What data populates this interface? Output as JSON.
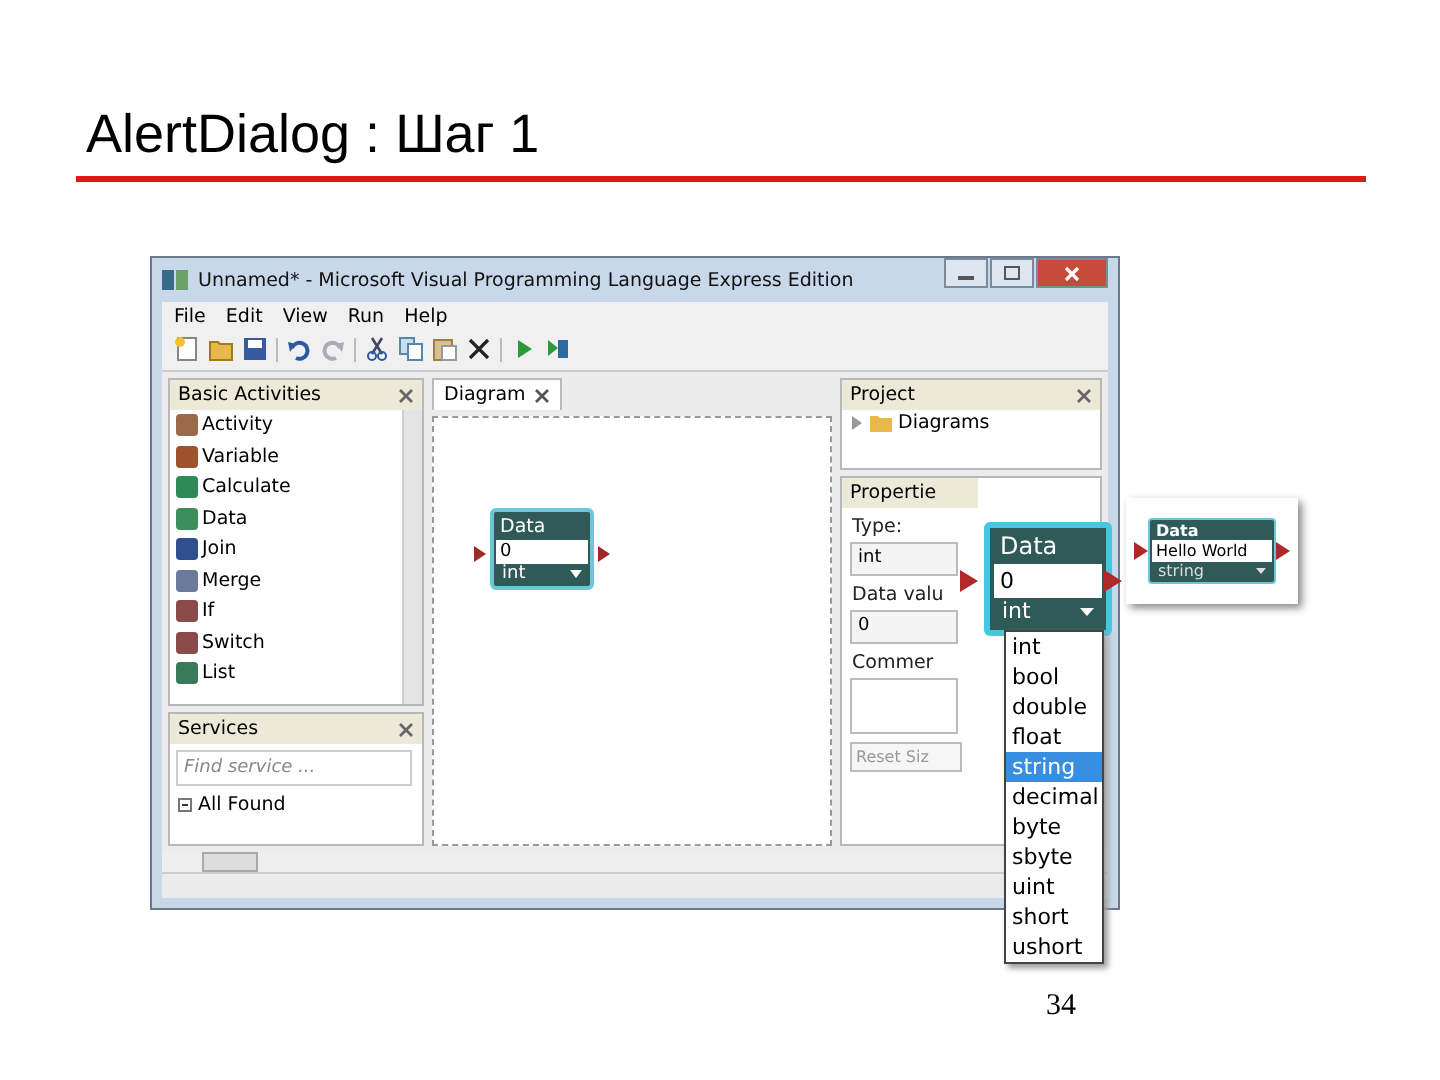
{
  "slide": {
    "title": "AlertDialog : Шаг 1",
    "page_number": "34"
  },
  "window": {
    "title": "Unnamed* - Microsoft Visual Programming Language  Express Edition"
  },
  "menu": [
    "File",
    "Edit",
    "View",
    "Run",
    "Help"
  ],
  "basic_activities": {
    "title": "Basic Activities",
    "items": [
      "Activity",
      "Variable",
      "Calculate",
      "Data",
      "Join",
      "Merge",
      "If",
      "Switch",
      "List"
    ]
  },
  "services": {
    "title": "Services",
    "search": {
      "placeholder": "Find service ..."
    },
    "tree": [
      {
        "label": "All Found",
        "expanded": true
      }
    ]
  },
  "diagram": {
    "tab": "Diagram",
    "node": {
      "title": "Data",
      "value": "0",
      "type": "int"
    }
  },
  "project": {
    "title": "Project",
    "items": [
      {
        "label": "Diagrams",
        "expanded": false
      }
    ]
  },
  "properties": {
    "title": "Propertie",
    "type_label": "Type:",
    "type_value": "int",
    "value_label": "Data valu",
    "value": "0",
    "comment_label": "Commer",
    "reset_button": "Reset Siz"
  },
  "zoom_node": {
    "title": "Data",
    "value": "0",
    "type": "int",
    "options": [
      {
        "label": "int",
        "selected": false
      },
      {
        "label": "bool",
        "selected": false
      },
      {
        "label": "double",
        "selected": false
      },
      {
        "label": "float",
        "selected": false
      },
      {
        "label": "string",
        "selected": true
      },
      {
        "label": "decimal",
        "selected": false
      },
      {
        "label": "byte",
        "selected": false
      },
      {
        "label": "sbyte",
        "selected": false
      },
      {
        "label": "uint",
        "selected": false
      },
      {
        "label": "short",
        "selected": false
      },
      {
        "label": "ushort",
        "selected": false
      }
    ]
  },
  "result_node": {
    "title": "Data",
    "value": "Hello World",
    "type": "string"
  }
}
